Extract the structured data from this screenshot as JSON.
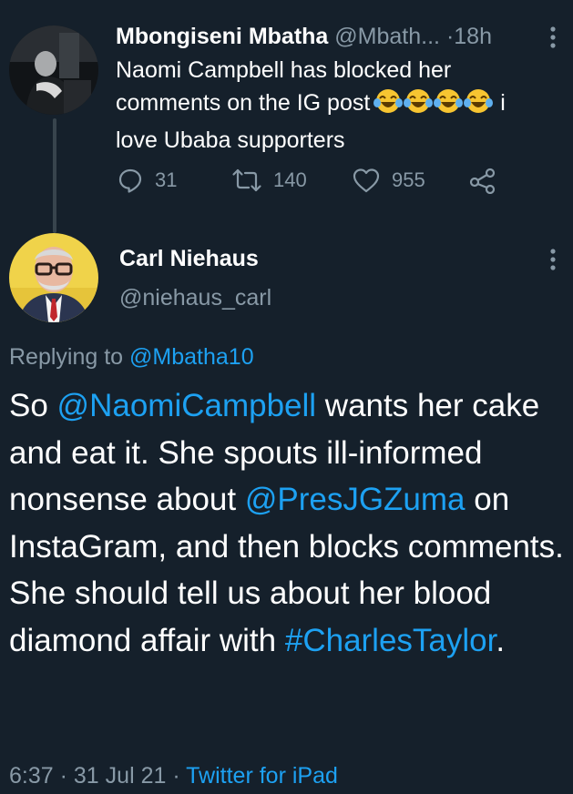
{
  "parent_tweet": {
    "display_name": "Mbongiseni Mbatha",
    "handle": "@Mbath...",
    "separator": "·",
    "time": "18h",
    "text_before_emoji": "Naomi Campbell has blocked her comments on the IG post",
    "emoji": [
      "face-with-tears-of-joy",
      "face-with-tears-of-joy",
      "face-with-tears-of-joy",
      "face-with-tears-of-joy"
    ],
    "text_after_emoji": "i love Ubaba supporters",
    "replies": "31",
    "retweets": "140",
    "likes": "955"
  },
  "main_tweet": {
    "display_name": "Carl Niehaus",
    "handle": "@niehaus_carl",
    "replying_prefix": "Replying to",
    "replying_to": "@Mbatha10",
    "body": {
      "part1": "So ",
      "mention1": "@NaomiCampbell",
      "part2": " wants her cake and eat it. She spouts ill-informed nonsense about ",
      "mention2": "@PresJGZuma",
      "part3": " on InstaGram, and then blocks comments. She should tell us about her blood diamond affair with ",
      "hashtag": "#CharlesTaylor",
      "part4": "."
    },
    "time": "6:37",
    "date": "31 Jul 21",
    "source": "Twitter for iPad",
    "dot": "·"
  },
  "colors": {
    "background": "#15202b",
    "text_primary": "#ffffff",
    "text_secondary": "#8899a6",
    "link": "#1da1f2",
    "divider": "#38444d"
  }
}
